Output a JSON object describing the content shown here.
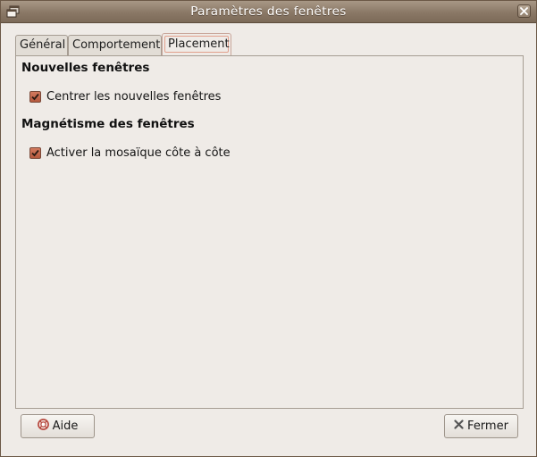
{
  "window": {
    "title": "Paramètres des fenêtres"
  },
  "tabs": [
    {
      "label": "Général",
      "active": false
    },
    {
      "label": "Comportement",
      "active": false
    },
    {
      "label": "Placement",
      "active": true
    }
  ],
  "placement": {
    "new_windows_heading": "Nouvelles fenêtres",
    "center_new_windows": {
      "label": "Centrer les nouvelles fenêtres",
      "checked": true
    },
    "magnetism_heading": "Magnétisme des fenêtres",
    "side_by_side_tiling": {
      "label": "Activer la mosaïque côte à côte",
      "checked": true
    }
  },
  "buttons": {
    "help": "Aide",
    "close": "Fermer"
  },
  "colors": {
    "titlebar": "#8a7866",
    "checkbox": "#c4694d",
    "window_bg": "#efebe7"
  }
}
